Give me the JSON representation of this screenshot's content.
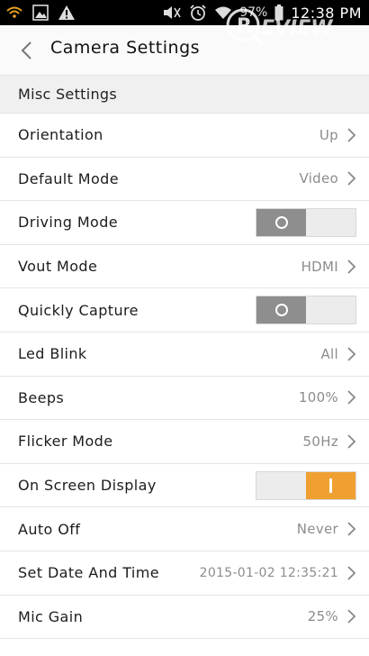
{
  "status_bar": {
    "icons": [
      "wifi-indicator-icon",
      "gallery-icon",
      "warning-icon",
      "mute-icon",
      "alarm-icon",
      "wifi-icon"
    ],
    "battery_percent": "97%",
    "time": "12:38 PM"
  },
  "header": {
    "title": "Camera Settings"
  },
  "section": {
    "title": "Misc Settings"
  },
  "colors": {
    "toggle_on": "#f0a030",
    "toggle_off_knob": "#8e8e8e"
  },
  "rows": [
    {
      "label": "Orientation",
      "value": "Up"
    },
    {
      "label": "Default Mode",
      "value": "Video"
    },
    {
      "label": "Driving Mode",
      "toggle": "off"
    },
    {
      "label": "Vout Mode",
      "value": "HDMI"
    },
    {
      "label": "Quickly Capture",
      "toggle": "off"
    },
    {
      "label": "Led Blink",
      "value": "All"
    },
    {
      "label": "Beeps",
      "value": "100%"
    },
    {
      "label": "Flicker Mode",
      "value": "50Hz"
    },
    {
      "label": "On Screen Display",
      "toggle": "on"
    },
    {
      "label": "Auto Off",
      "value": "Never"
    },
    {
      "label": "Set Date And Time",
      "value": "2015-01-02 12:35:21"
    },
    {
      "label": "Mic Gain",
      "value": "25%"
    }
  ]
}
